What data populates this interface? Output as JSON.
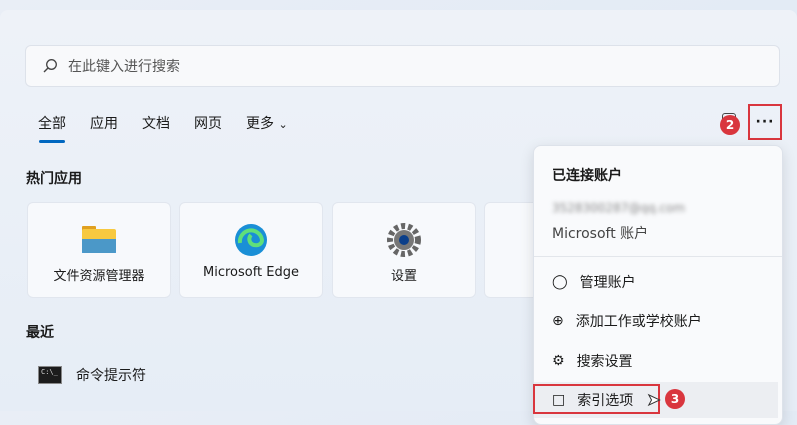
{
  "search": {
    "placeholder": "在此键入进行搜索"
  },
  "tabs": [
    {
      "label": "全部"
    },
    {
      "label": "应用"
    },
    {
      "label": "文档"
    },
    {
      "label": "网页"
    },
    {
      "label": "更多"
    }
  ],
  "top_apps": {
    "heading": "热门应用",
    "items": [
      {
        "label": "文件资源管理器"
      },
      {
        "label": "Microsoft Edge"
      },
      {
        "label": "设置"
      }
    ]
  },
  "recent": {
    "heading": "最近",
    "items": [
      {
        "label": "命令提示符"
      }
    ]
  },
  "account_menu": {
    "title": "已连接账户",
    "email": "3528300287@qq.com",
    "account_type": "Microsoft 账户",
    "items": [
      {
        "label": "管理账户"
      },
      {
        "label": "添加工作或学校账户"
      },
      {
        "label": "搜索设置"
      },
      {
        "label": "索引选项"
      }
    ]
  },
  "annotations": {
    "badge2": "2",
    "badge3": "3"
  },
  "colors": {
    "accent": "#0067c0",
    "annotation_red": "#d9363e"
  }
}
